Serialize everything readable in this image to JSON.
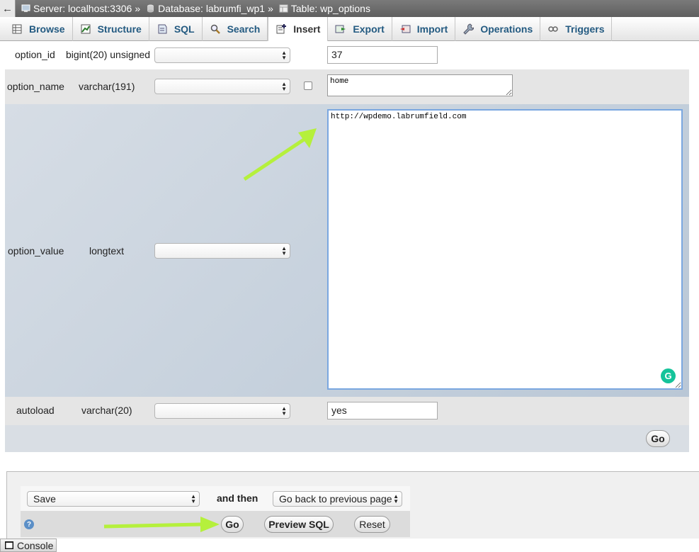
{
  "breadcrumb": {
    "server": "Server: localhost:3306",
    "sep": "»",
    "database": "Database: labrumfi_wp1",
    "table": "Table: wp_options"
  },
  "tabs": [
    {
      "label": "Browse",
      "icon": "browse-icon"
    },
    {
      "label": "Structure",
      "icon": "structure-icon"
    },
    {
      "label": "SQL",
      "icon": "sql-icon"
    },
    {
      "label": "Search",
      "icon": "search-icon"
    },
    {
      "label": "Insert",
      "icon": "insert-icon",
      "active": true
    },
    {
      "label": "Export",
      "icon": "export-icon"
    },
    {
      "label": "Import",
      "icon": "import-icon"
    },
    {
      "label": "Operations",
      "icon": "operations-icon"
    },
    {
      "label": "Triggers",
      "icon": "triggers-icon"
    }
  ],
  "fields": {
    "option_id": {
      "name": "option_id",
      "type": "bigint(20) unsigned",
      "value": "37"
    },
    "option_name": {
      "name": "option_name",
      "type": "varchar(191)",
      "value": "home"
    },
    "option_value": {
      "name": "option_value",
      "type": "longtext",
      "value": "http://wpdemo.labrumfield.com"
    },
    "autoload": {
      "name": "autoload",
      "type": "varchar(20)",
      "value": "yes"
    }
  },
  "form_go_label": "Go",
  "footer": {
    "action_select": "Save",
    "and_then": "and then",
    "after_select": "Go back to previous page",
    "go_label": "Go",
    "preview_label": "Preview SQL",
    "reset_label": "Reset"
  },
  "console_label": "Console",
  "colors": {
    "accent": "#235a81",
    "arrow": "#b5f03c",
    "row_alt": "#e5e5e5",
    "row_blue": "#c8d4e0"
  }
}
